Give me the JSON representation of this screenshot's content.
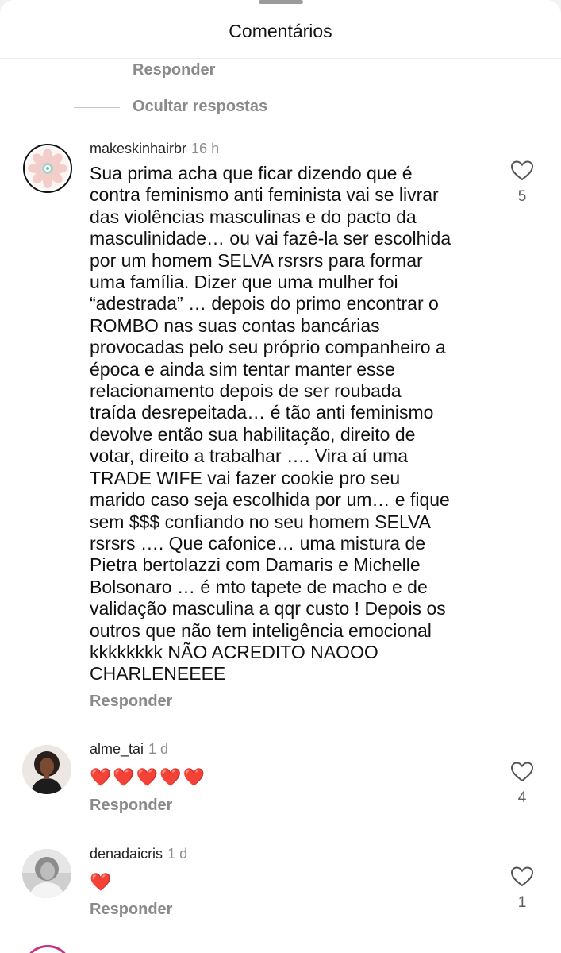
{
  "sheet": {
    "title": "Comentários"
  },
  "previous_thread": {
    "reply_label": "Responder",
    "hide_replies_label": "Ocultar respostas"
  },
  "comments": [
    {
      "username": "makeskinhairbr",
      "time": "16 h",
      "text": "Sua prima acha que ficar dizendo que é\ncontra feminismo anti feminista vai se livrar\ndas violências masculinas e do pacto da\nmasculinidade… ou vai fazê-la ser escolhida\npor um homem SELVA rsrsrs  para formar\numa família. Dizer que uma mulher foi\n“adestrada” … depois do primo encontrar o\nROMBO nas suas contas bancárias\nprovocadas pelo seu próprio companheiro a\népoca e ainda sim tentar manter esse\nrelacionamento depois de ser roubada\ntraída desrepeitada… é tão anti feminismo\ndevolve então sua habilitação, direito de\nvotar, direito a trabalhar …. Vira aí uma\nTRADE WIFE vai fazer cookie pro seu\nmarido caso seja escolhida por um… e fique\nsem $$$ confiando no seu homem SELVA\nrsrsrs …. Que cafonice… uma mistura de\nPietra bertolazzi com Damaris e Michelle\nBolsonaro … é mto tapete de macho e de\nvalidação masculina a qqr custo ! Depois os\noutros que não tem inteligência emocional\nkkkkkkkk NÃO ACREDITO NAOOO\nCHARLENEEEE",
      "reply_label": "Responder",
      "likes": "5",
      "like_icon": "heart-outline-icon"
    },
    {
      "username": "alme_tai",
      "time": "1 d",
      "text": "❤️❤️❤️❤️❤️",
      "reply_label": "Responder",
      "likes": "4",
      "like_icon": "heart-outline-icon"
    },
    {
      "username": "denadaicris",
      "time": "1 d",
      "text": "❤️",
      "reply_label": "Responder",
      "likes": "1",
      "like_icon": "heart-outline-icon"
    }
  ],
  "colors": {
    "secondary_text": "#8a8a8a",
    "heart_emoji": "#e0245e",
    "story_ring": "#c13584"
  }
}
